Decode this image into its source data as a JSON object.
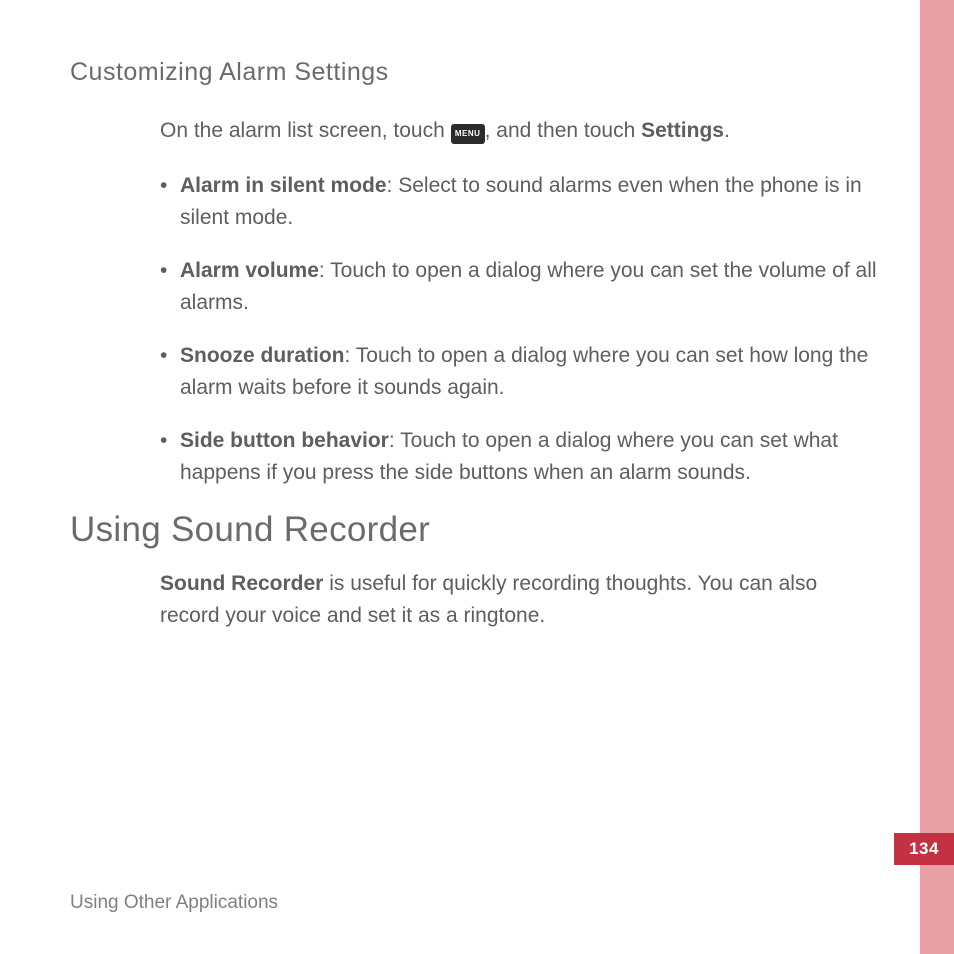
{
  "heading_custom": "Customizing Alarm Settings",
  "lead_a": "On the alarm list screen, touch ",
  "menu_chip": "MENU",
  "lead_b": ", and then touch ",
  "lead_bold": "Settings",
  "lead_c": ".",
  "bullets": [
    {
      "bold": "Alarm in silent mode",
      "tail": ": Select to sound alarms even when the phone is in silent mode."
    },
    {
      "bold": "Alarm volume",
      "tail": ": Touch to open a dialog where you can set the volume of all alarms."
    },
    {
      "bold": "Snooze duration",
      "tail": ": Touch to open a dialog where you can set how long the alarm waits before it sounds again."
    },
    {
      "bold": "Side button behavior",
      "tail": ": Touch to open a dialog where you can set what happens if you press the side buttons when an alarm sounds."
    }
  ],
  "heading_sound": "Using Sound Recorder",
  "sr_bold": "Sound Recorder",
  "sr_tail": " is useful for quickly recording thoughts. You can also record your voice and set it as a ringtone.",
  "footer": "Using Other Applications",
  "page_number": "134"
}
